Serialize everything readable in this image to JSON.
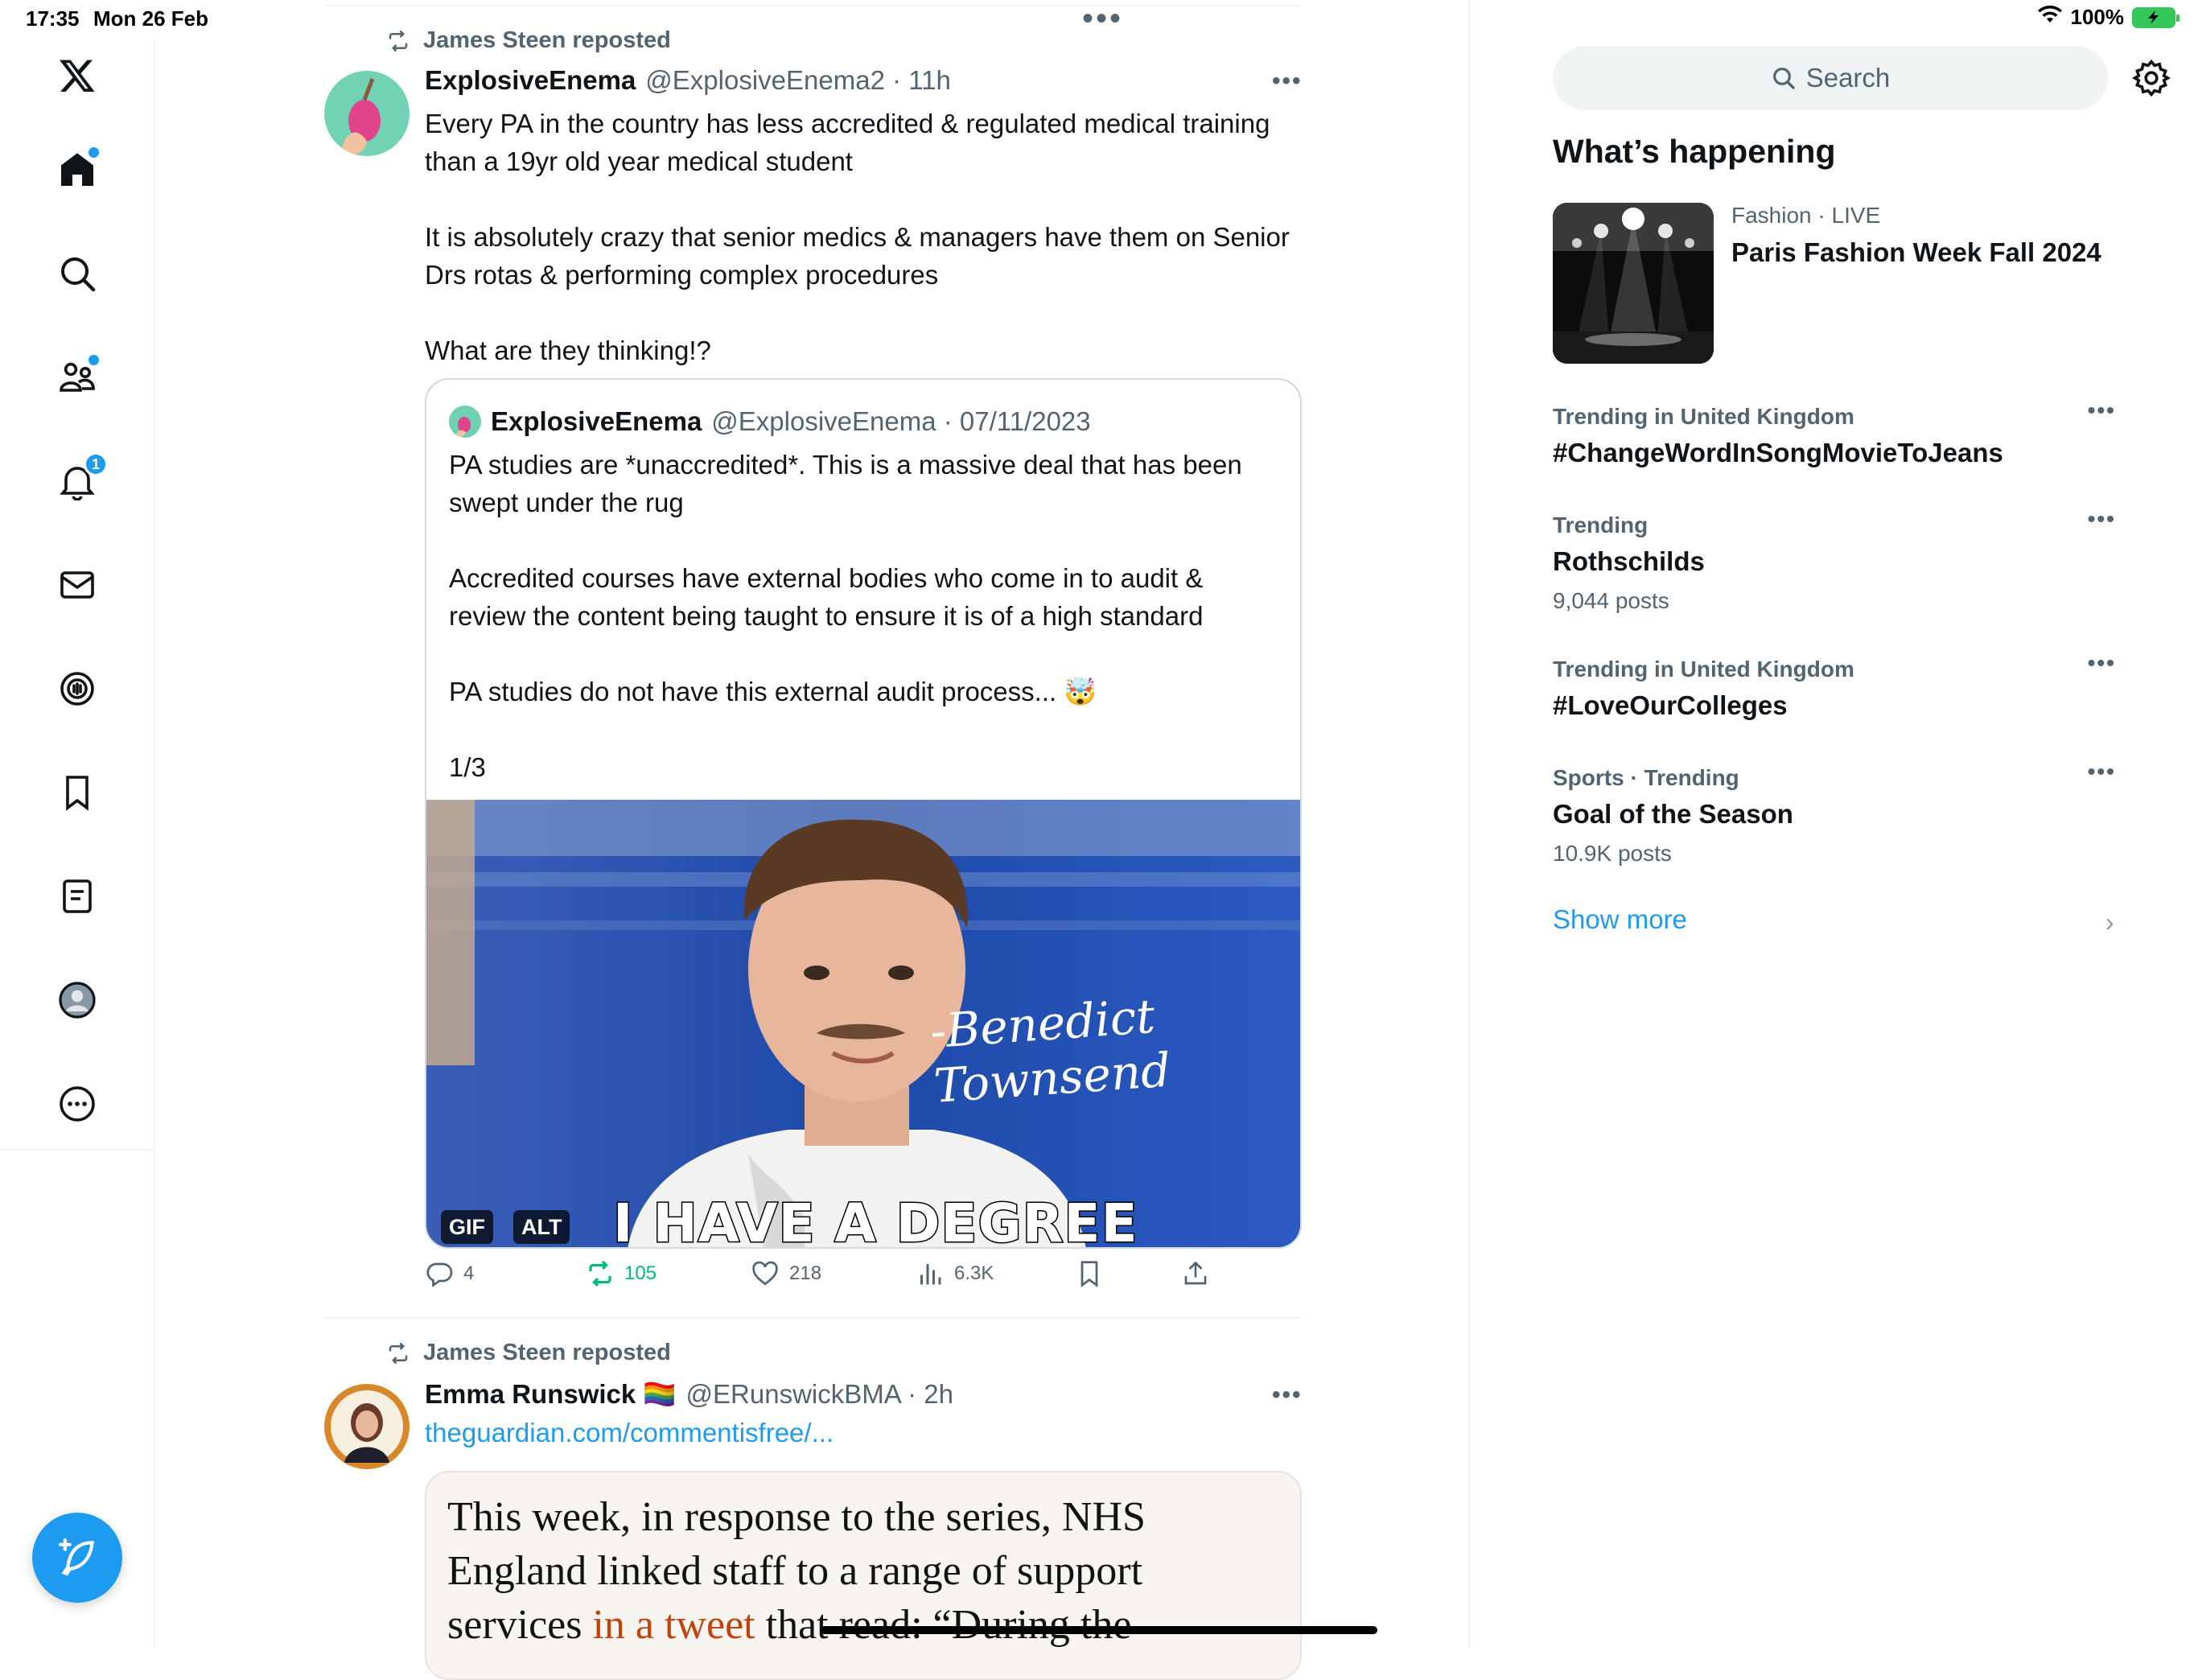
{
  "status_bar": {
    "time": "17:35",
    "date": "Mon 26 Feb",
    "battery": "100%"
  },
  "nav": {
    "items": [
      "x-logo",
      "home",
      "search",
      "communities",
      "notifications",
      "messages",
      "grok",
      "bookmarks",
      "lists",
      "profile",
      "more"
    ],
    "notifications_badge": "1"
  },
  "timeline": {
    "tweets": [
      {
        "repost_label": "James Steen reposted",
        "name": "ExplosiveEnema",
        "handle": "@ExplosiveEnema2 · 11h",
        "text": "Every PA in the country has less accredited & regulated medical training than a 19yr old year medical student\n\nIt is absolutely crazy that senior medics & managers have them on Senior Drs rotas & performing complex procedures\n\nWhat are they thinking!?",
        "quote": {
          "name": "ExplosiveEnema",
          "handle": "@ExplosiveEnema · 07/11/2023",
          "text": "PA studies are *unaccredited*. This is a massive deal that has been swept under the rug\n\nAccredited courses have external bodies who come in to audit & review the content being taught to ensure it is of a high standard\n\nPA studies do not have this external audit process... 🤯\n\n1/3",
          "media": {
            "tag_gif": "GIF",
            "tag_alt": "ALT",
            "caption": "I HAVE A DEGREE",
            "name_overlay": "-Benedict Townsend"
          }
        },
        "replies": "4",
        "reposts": "105",
        "likes": "218",
        "views": "6.3K"
      },
      {
        "repost_label": "James Steen reposted",
        "name": "Emma Runswick 🏳️‍🌈",
        "handle": "@ERunswickBMA · 2h",
        "link": "theguardian.com/commentisfree/...",
        "card": {
          "text_before": "This week, in response to the series, NHS England linked staff to a range of support services ",
          "text_link": "in a tweet",
          "text_after": " that read: “During the"
        }
      }
    ]
  },
  "sidebar": {
    "search_placeholder": "Search",
    "section_title": "What’s happening",
    "news": {
      "category": "Fashion · LIVE",
      "title": "Paris Fashion Week Fall 2024"
    },
    "trends": [
      {
        "context": "Trending in United Kingdom",
        "name": "#ChangeWordInSongMovieToJeans",
        "count": ""
      },
      {
        "context": "Trending",
        "name": "Rothschilds",
        "count": "9,044 posts"
      },
      {
        "context": "Trending in United Kingdom",
        "name": "#LoveOurColleges",
        "count": ""
      },
      {
        "context": "Sports · Trending",
        "name": "Goal of the Season",
        "count": "10.9K posts"
      }
    ],
    "show_more": "Show more"
  },
  "colors": {
    "accent": "#1d9bf0",
    "repost_green": "#00ba7c",
    "text": "#0f1419",
    "secondary": "#536471"
  }
}
